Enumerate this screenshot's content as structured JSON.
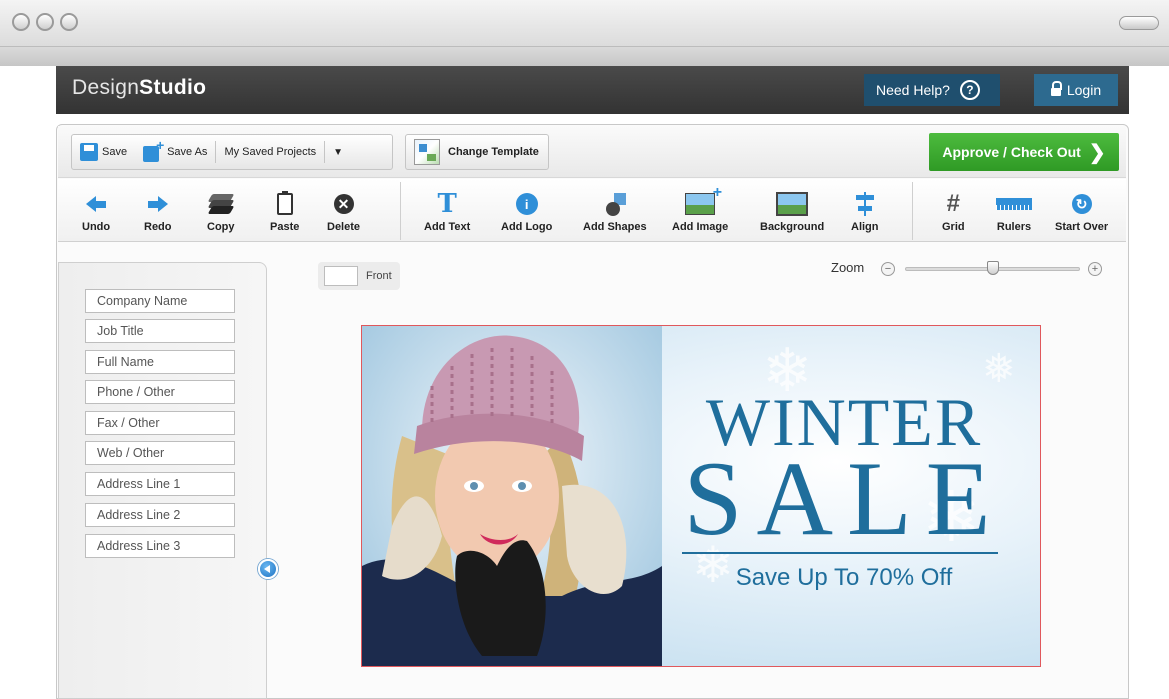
{
  "app": {
    "logo_light": "Design",
    "logo_bold": "Studio",
    "help_label": "Need Help?",
    "help_icon_glyph": "?",
    "login_label": "Login"
  },
  "toolbar": {
    "save_label": "Save",
    "save_as_label": "Save As",
    "saved_projects_label": "My Saved Projects",
    "saved_projects_caret": "▼",
    "change_template_label": "Change Template",
    "approve_label": "Approve / Check Out",
    "approve_chevron": "❯"
  },
  "tools": {
    "undo": "Undo",
    "redo": "Redo",
    "copy": "Copy",
    "paste": "Paste",
    "delete": "Delete",
    "add_text": "Add Text",
    "add_logo": "Add Logo",
    "add_shapes": "Add Shapes",
    "add_image": "Add Image",
    "background": "Background",
    "align": "Align",
    "grid": "Grid",
    "rulers": "Rulers",
    "start_over": "Start Over"
  },
  "tool_glyphs": {
    "delete": "✕",
    "add_text": "T",
    "add_logo": "i",
    "grid": "#",
    "start_over": "↻"
  },
  "fields": [
    "Company Name",
    "Job Title",
    "Full Name",
    "Phone / Other",
    "Fax / Other",
    "Web / Other",
    "Address Line 1",
    "Address Line 2",
    "Address Line 3"
  ],
  "canvas": {
    "side_tab_label": "Front",
    "zoom_label": "Zoom",
    "zoom_minus": "−",
    "zoom_plus": "+",
    "zoom_level_fraction": 0.5,
    "headline_1": "WINTER",
    "headline_2": "SALE",
    "offer_text": "Save Up To 70% Off"
  },
  "colors": {
    "header_bg": "#3a3a3a",
    "accent_blue": "#2f8fd8",
    "approve_green": "#36a82b",
    "headline_blue": "#1f6e9c",
    "canvas_border": "#e0585c"
  },
  "icons": {
    "window_controls": [
      "window-dot-icon",
      "window-dot-icon",
      "window-dot-icon"
    ],
    "save": "floppy-disk-icon",
    "undo": "arrow-left-icon",
    "redo": "arrow-right-icon",
    "copy": "stack-layers-icon",
    "paste": "clipboard-icon",
    "delete": "circle-x-icon",
    "collapse": "chevron-left-circle-icon"
  }
}
